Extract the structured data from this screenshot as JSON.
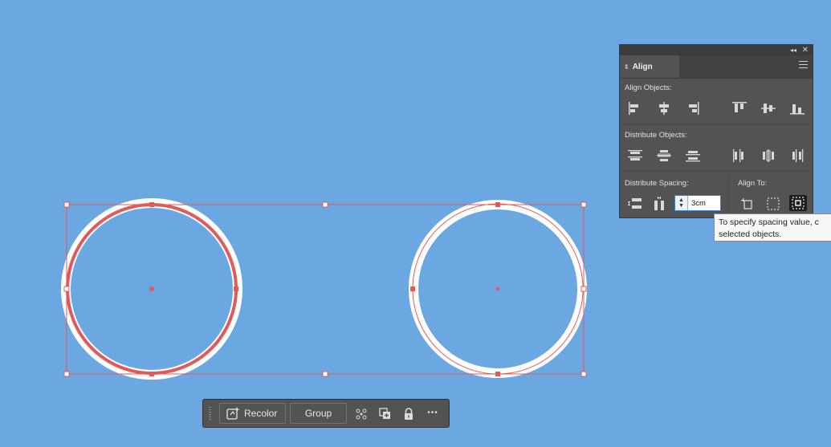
{
  "panel": {
    "tab_label": "Align",
    "align_objects_label": "Align Objects:",
    "distribute_objects_label": "Distribute Objects:",
    "distribute_spacing_label": "Distribute Spacing:",
    "align_to_label": "Align To:",
    "spacing_value": "3cm",
    "collapse_glyph": "◂◂",
    "close_glyph": "✕",
    "tab_glyph": "⇕"
  },
  "tooltip": {
    "line1": "To specify spacing value, c",
    "line2": "selected objects."
  },
  "taskbar": {
    "recolor_label": "Recolor",
    "group_label": "Group",
    "more_glyph": "•••"
  },
  "colors": {
    "canvas": "#6ba7e1",
    "selection": "#e05a5a",
    "ring": "#ffffff",
    "panel": "#535353"
  },
  "icons": [
    "align-left-icon",
    "align-horizontal-center-icon",
    "align-right-icon",
    "align-top-icon",
    "align-vertical-center-icon",
    "align-bottom-icon",
    "distribute-top-icon",
    "distribute-vertical-center-icon",
    "distribute-bottom-icon",
    "distribute-left-icon",
    "distribute-horizontal-center-icon",
    "distribute-right-icon",
    "vertical-distribute-space-icon",
    "horizontal-distribute-space-icon",
    "align-to-artboard-icon",
    "align-to-selection-icon",
    "align-to-key-object-icon",
    "recolor-icon",
    "edit-pattern-icon",
    "duplicate-icon",
    "lock-icon",
    "more-icon"
  ]
}
